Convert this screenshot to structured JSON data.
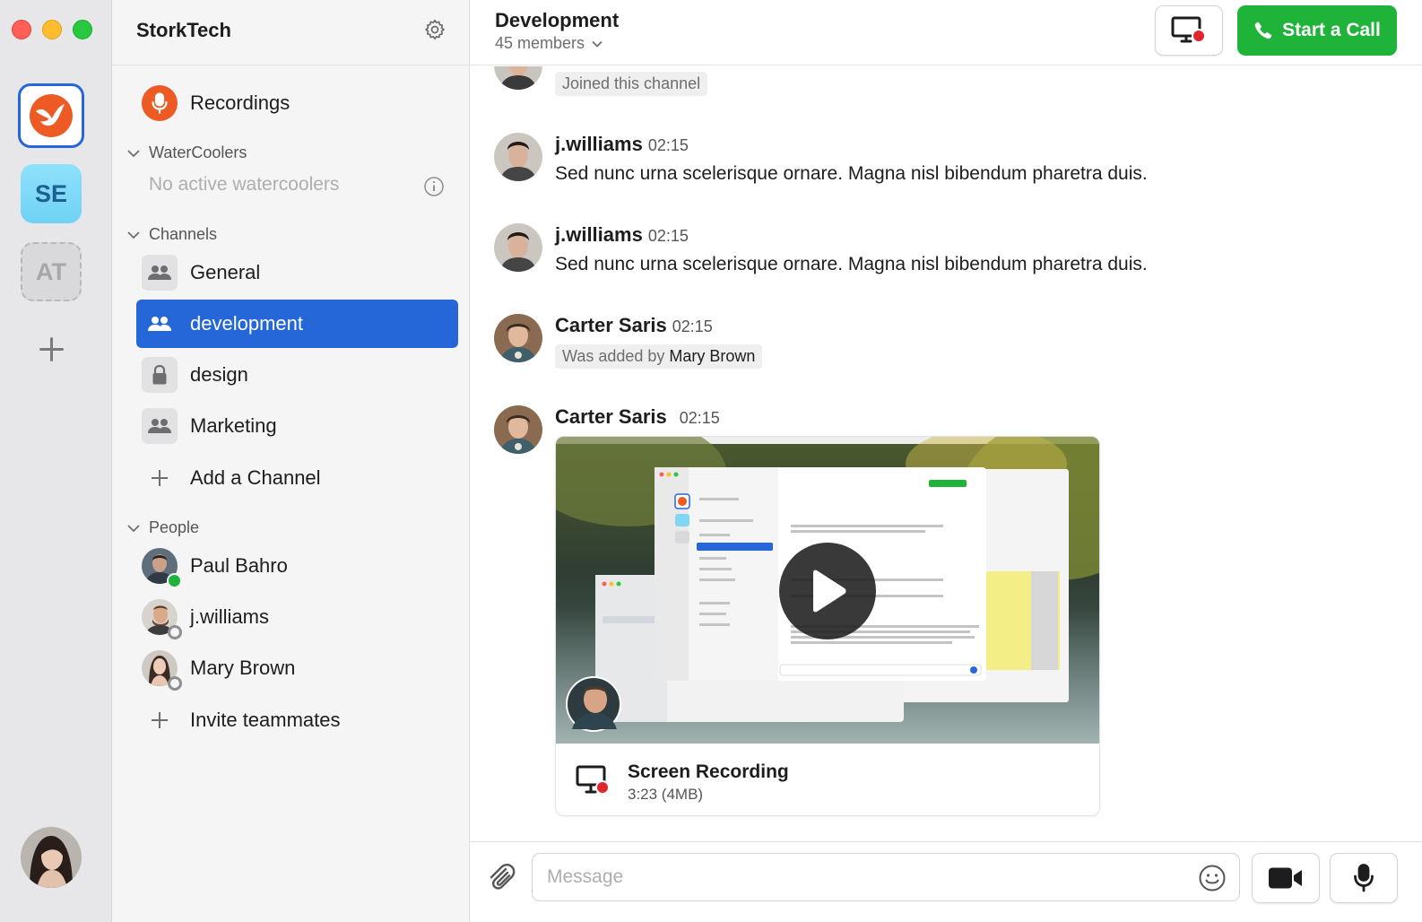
{
  "workspaces": [
    {
      "name": "StorkTech",
      "initials": ""
    },
    {
      "name": "SE",
      "initials": "SE"
    },
    {
      "name": "AT",
      "initials": "AT"
    }
  ],
  "sidebar": {
    "workspace_title": "StorkTech",
    "recordings_label": "Recordings",
    "watercoolers": {
      "header": "WaterCoolers",
      "empty": "No active watercoolers"
    },
    "channels": {
      "header": "Channels",
      "items": [
        {
          "label": "General",
          "icon": "group-icon",
          "active": false
        },
        {
          "label": "development",
          "icon": "group-icon",
          "active": true
        },
        {
          "label": "design",
          "icon": "lock-icon",
          "active": false
        },
        {
          "label": "Marketing",
          "icon": "group-icon",
          "active": false
        }
      ],
      "add_label": "Add a Channel"
    },
    "people": {
      "header": "People",
      "items": [
        {
          "name": "Paul Bahro",
          "online": true
        },
        {
          "name": "j.williams",
          "online": false
        },
        {
          "name": "Mary Brown",
          "online": false
        }
      ],
      "invite_label": "Invite teammates"
    }
  },
  "header": {
    "channel_name": "Development",
    "members": "45 members",
    "call_label": "Start a Call"
  },
  "messages": [
    {
      "type": "system",
      "text": "Joined this channel"
    },
    {
      "author": "j.williams",
      "time": "02:15",
      "text": "Sed nunc urna scelerisque ornare. Magna nisl bibendum pharetra duis."
    },
    {
      "author": "j.williams",
      "time": "02:15",
      "text": "Sed nunc urna scelerisque ornare. Magna nisl bibendum pharetra duis."
    },
    {
      "author": "Carter Saris",
      "time": "02:15",
      "system_prefix": "Was added by",
      "system_actor": "Mary Brown"
    },
    {
      "author": "Carter Saris",
      "time": "02:15",
      "attachment": {
        "title": "Screen Recording",
        "meta": "3:23 (4MB)"
      }
    }
  ],
  "composer": {
    "placeholder": "Message"
  },
  "colors": {
    "accent": "#2567d8",
    "call_green": "#1fb33a",
    "recording_orange": "#ee5a24",
    "record_dot": "#e0262d"
  }
}
